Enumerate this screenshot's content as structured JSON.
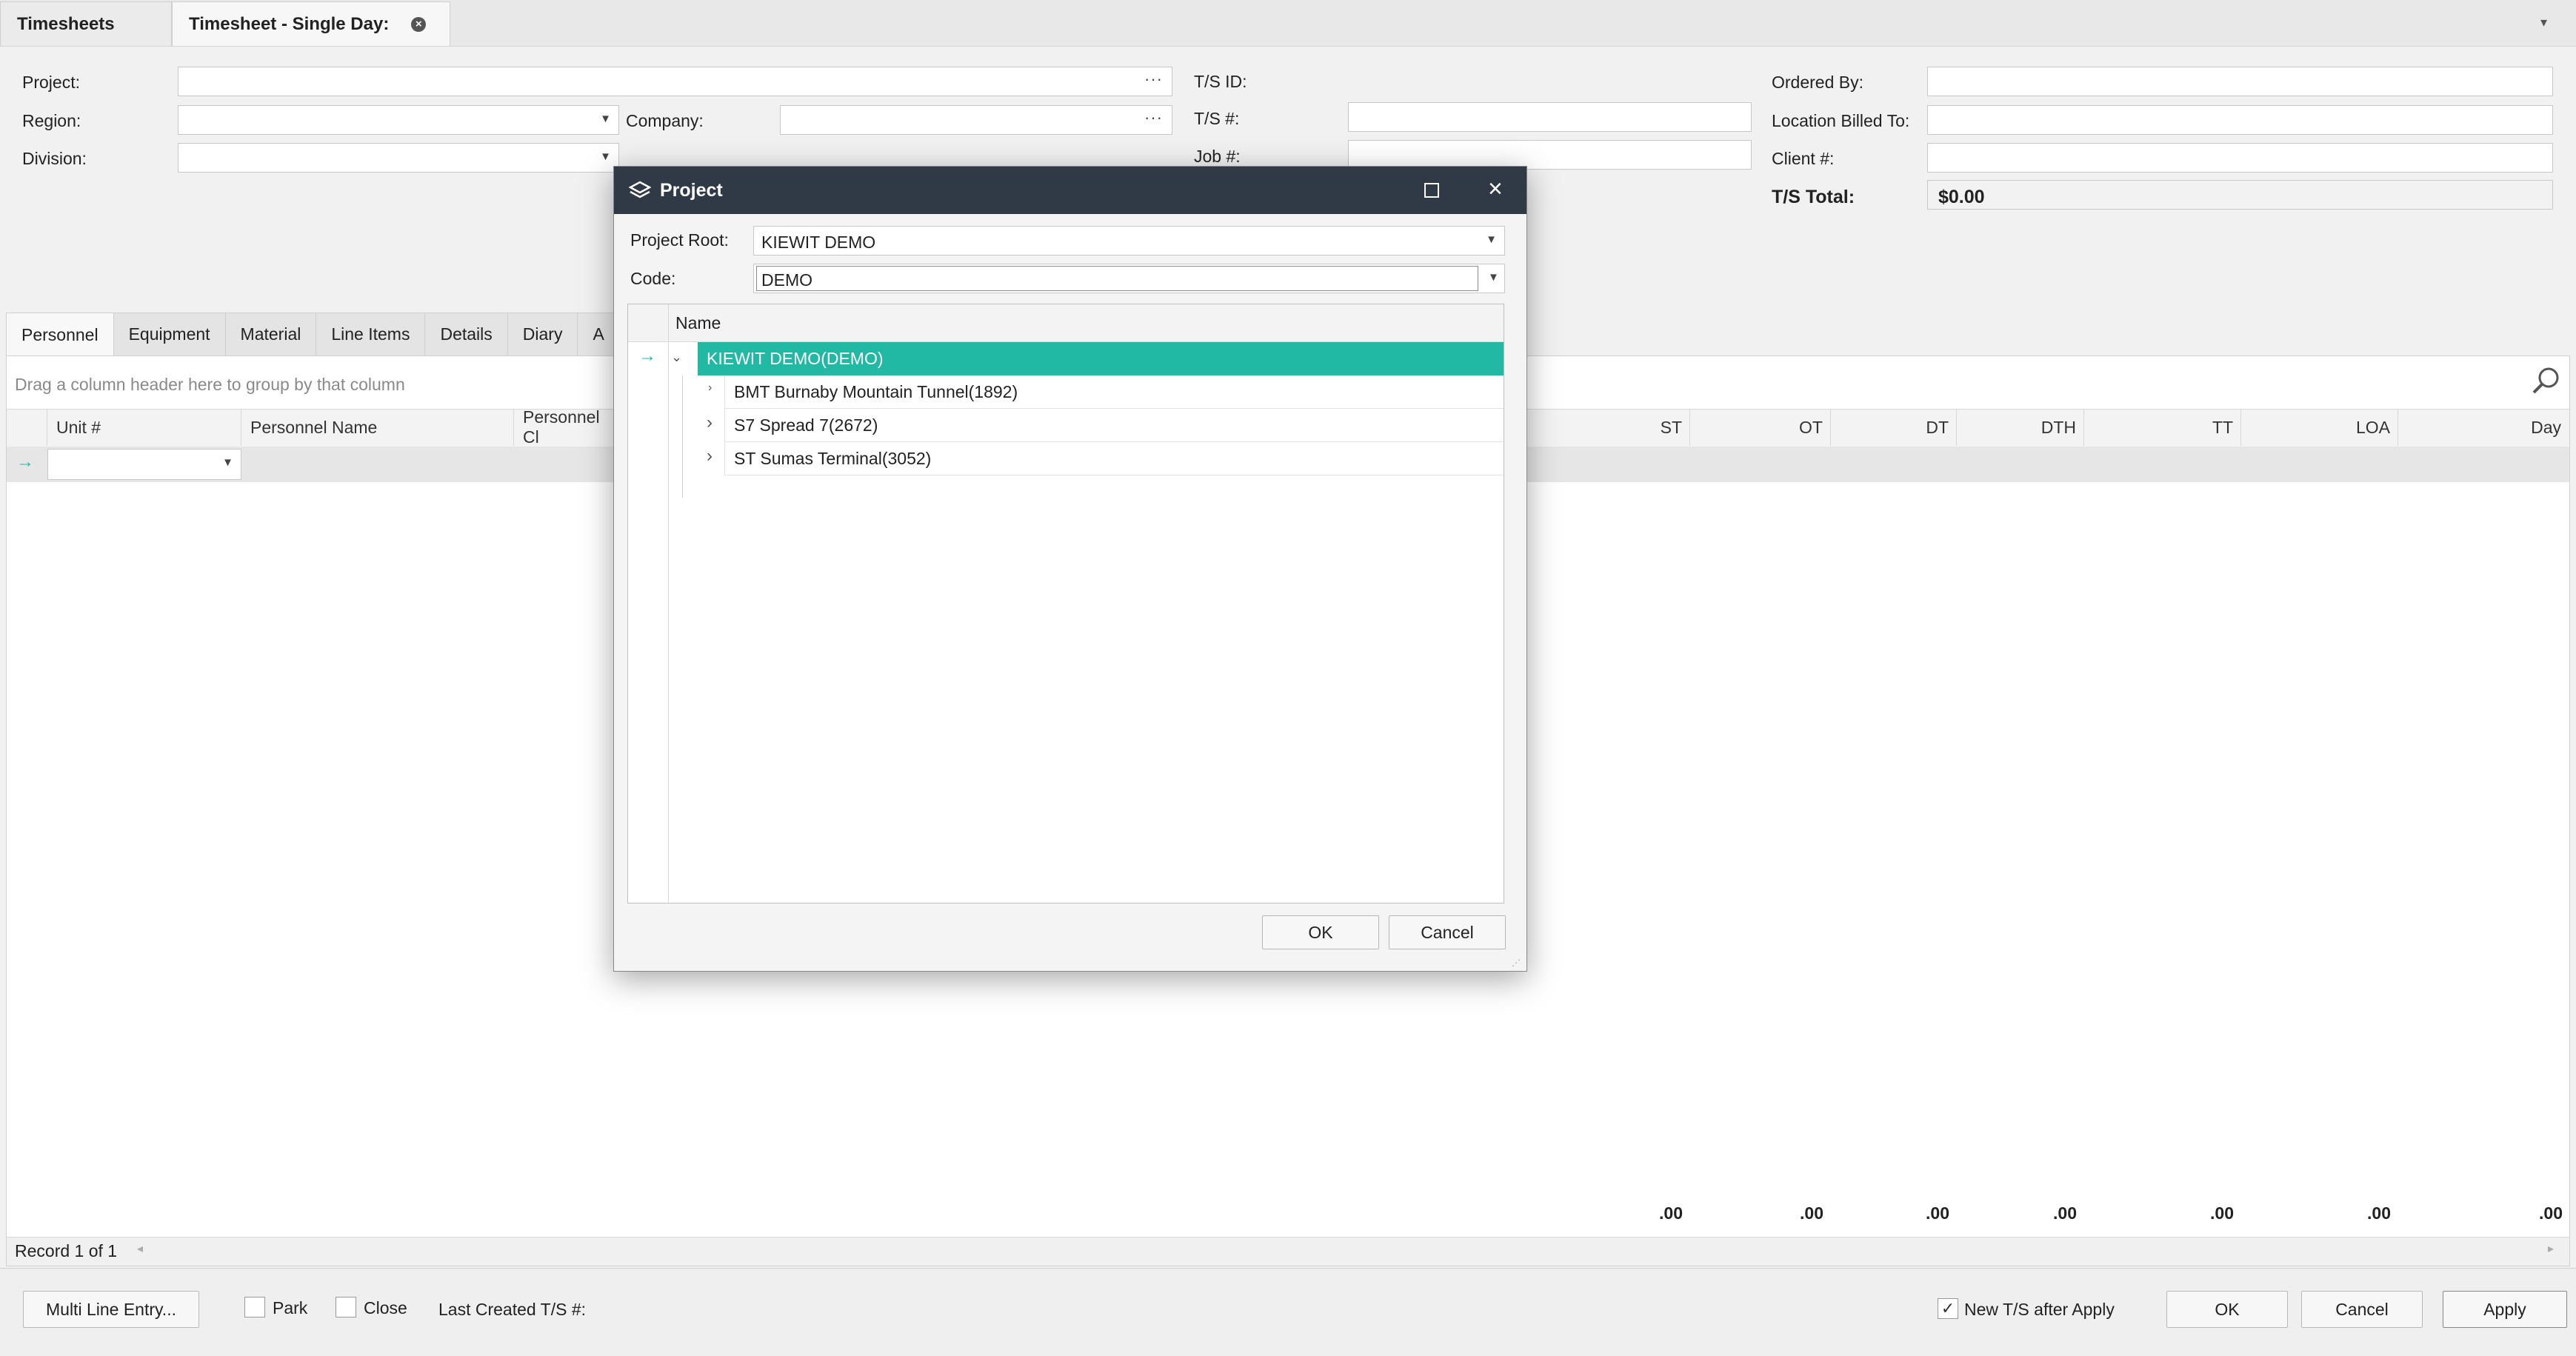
{
  "tabs": [
    {
      "label": "Timesheets"
    },
    {
      "label": "Timesheet - Single Day:"
    }
  ],
  "form": {
    "project_label": "Project:",
    "region_label": "Region:",
    "division_label": "Division:",
    "company_label": "Company:",
    "ts_id_label": "T/S ID:",
    "ts_num_label": "T/S #:",
    "job_label": "Job #:",
    "ordered_by_label": "Ordered By:",
    "location_billed_label": "Location Billed To:",
    "client_label": "Client #:",
    "ts_total_label": "T/S Total:",
    "ts_total_value": "$0.00"
  },
  "detail_tabs": [
    "Personnel",
    "Equipment",
    "Material",
    "Line Items",
    "Details",
    "Diary",
    "A"
  ],
  "grid": {
    "group_hint": "Drag a column header here to group by that column",
    "columns_left": [
      "Unit #",
      "Personnel Name",
      "Personnel Cl"
    ],
    "columns_right": [
      "ST",
      "OT",
      "DT",
      "DTH",
      "TT",
      "LOA",
      "Day"
    ],
    "totals": [
      ".00",
      ".00",
      ".00",
      ".00",
      ".00",
      ".00",
      ".00"
    ],
    "record_text": "Record 1 of 1"
  },
  "footer": {
    "multi_line_label": "Multi Line Entry...",
    "park_label": "Park",
    "close_label": "Close",
    "last_created_label": "Last Created T/S #:",
    "new_ts_label": "New T/S after Apply",
    "new_ts_checked": true,
    "ok_label": "OK",
    "cancel_label": "Cancel",
    "apply_label": "Apply"
  },
  "dialog": {
    "title": "Project",
    "project_root_label": "Project Root:",
    "project_root_value": "KIEWIT DEMO",
    "code_label": "Code:",
    "code_value": "DEMO",
    "tree_header": "Name",
    "tree_items": [
      {
        "label": "KIEWIT DEMO(DEMO)",
        "expanded": true,
        "selected": true
      },
      {
        "label": "BMT Burnaby Mountain Tunnel(1892)"
      },
      {
        "label": "S7 Spread 7(2672)",
        "expandable": true
      },
      {
        "label": "ST Sumas Terminal(3052)",
        "expandable": true
      }
    ],
    "ok_label": "OK",
    "cancel_label": "Cancel"
  },
  "colors": {
    "selection": "#21b8a4",
    "title_bar": "#2f3a46",
    "row_arrow": "#21b8a4"
  }
}
